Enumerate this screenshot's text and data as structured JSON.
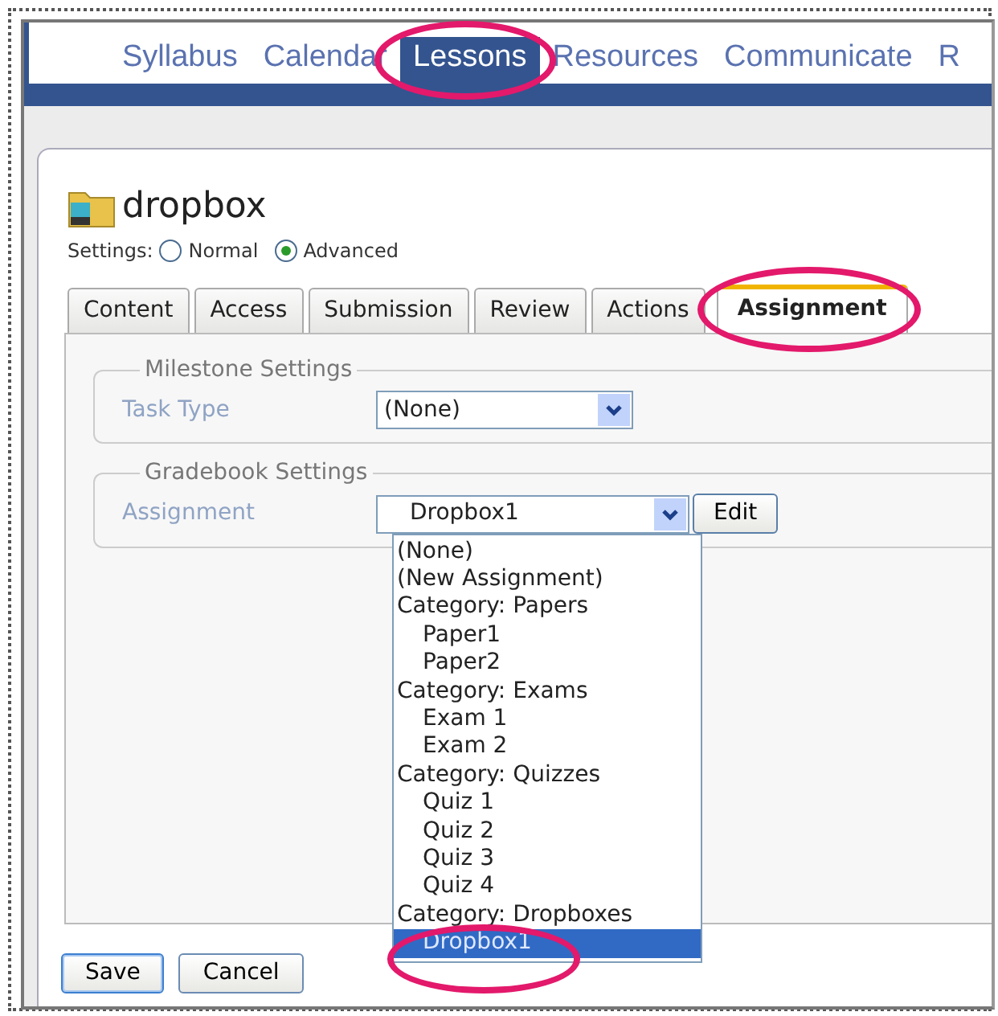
{
  "nav": [
    {
      "label": "Syllabus",
      "selected": false,
      "highlighted": false
    },
    {
      "label": "Calendar",
      "selected": false,
      "highlighted": false
    },
    {
      "label": "Lessons",
      "selected": true,
      "highlighted": true
    },
    {
      "label": "Resources",
      "selected": false,
      "highlighted": false
    },
    {
      "label": "Communicate",
      "selected": false,
      "highlighted": false
    },
    {
      "label": "R",
      "selected": false,
      "highlighted": false
    }
  ],
  "title": "dropbox",
  "settings": {
    "label": "Settings:",
    "options": [
      {
        "label": "Normal",
        "selected": false
      },
      {
        "label": "Advanced",
        "selected": true
      }
    ]
  },
  "tabs": [
    {
      "label": "Content",
      "selected": false,
      "highlighted": false
    },
    {
      "label": "Access",
      "selected": false,
      "highlighted": false
    },
    {
      "label": "Submission",
      "selected": false,
      "highlighted": false
    },
    {
      "label": "Review",
      "selected": false,
      "highlighted": false
    },
    {
      "label": "Actions",
      "selected": false,
      "highlighted": false
    },
    {
      "label": "Assignment",
      "selected": true,
      "highlighted": true
    }
  ],
  "milestone": {
    "legend": "Milestone Settings",
    "label": "Task Type",
    "value": "(None)"
  },
  "gradebook": {
    "legend": "Gradebook Settings",
    "label": "Assignment",
    "value": "Dropbox1",
    "button": "Edit",
    "options": [
      {
        "label": "(None)",
        "selected": false,
        "highlighted": false
      },
      {
        "label": "(New Assignment)",
        "selected": false,
        "highlighted": false
      },
      {
        "label": "Category: Papers",
        "selected": false,
        "highlighted": false,
        "children": [
          {
            "label": "Paper1",
            "selected": false,
            "highlighted": false
          },
          {
            "label": "Paper2",
            "selected": false,
            "highlighted": false
          }
        ]
      },
      {
        "label": "Category: Exams",
        "selected": false,
        "highlighted": false,
        "children": [
          {
            "label": "Exam 1",
            "selected": false,
            "highlighted": false
          },
          {
            "label": "Exam 2",
            "selected": false,
            "highlighted": false
          }
        ]
      },
      {
        "label": "Category: Quizzes",
        "selected": false,
        "highlighted": false,
        "children": [
          {
            "label": "Quiz 1",
            "selected": false,
            "highlighted": false
          },
          {
            "label": "Quiz 2",
            "selected": false,
            "highlighted": false
          },
          {
            "label": "Quiz 3",
            "selected": false,
            "highlighted": false
          },
          {
            "label": "Quiz 4",
            "selected": false,
            "highlighted": false
          }
        ]
      },
      {
        "label": "Category: Dropboxes",
        "selected": false,
        "highlighted": false,
        "children": [
          {
            "label": "Dropbox1",
            "selected": true,
            "highlighted": true
          }
        ]
      }
    ]
  },
  "buttons": [
    "Save",
    "Cancel"
  ]
}
